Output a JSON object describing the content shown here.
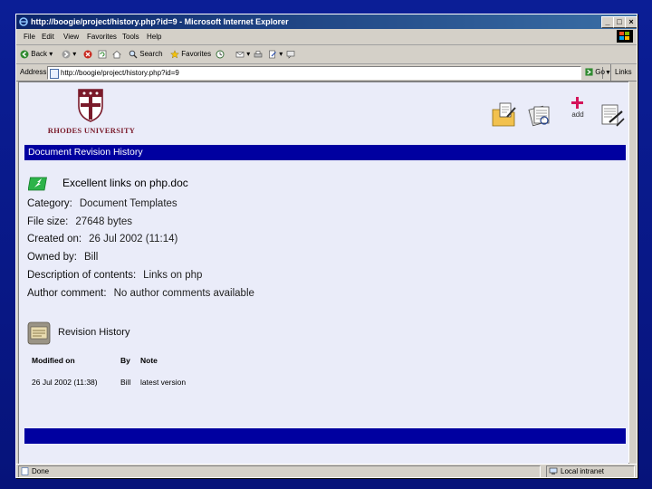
{
  "window": {
    "title": "http://boogie/project/history.php?id=9 - Microsoft Internet Explorer",
    "min": "_",
    "max": "□",
    "close": "×"
  },
  "menu": [
    "File",
    "Edit",
    "View",
    "Favorites",
    "Tools",
    "Help"
  ],
  "toolbar": {
    "back": "Back",
    "search": "Search",
    "favorites": "Favorites"
  },
  "address": {
    "label": "Address",
    "url": "http://boogie/project/history.php?id=9",
    "go": "Go",
    "links": "Links"
  },
  "logo": {
    "text": "RHODES UNIVERSITY"
  },
  "header_icons": {
    "add_label": "add"
  },
  "section": {
    "title": "Document Revision History"
  },
  "document": {
    "title": "Excellent links on php.doc",
    "fields": [
      {
        "label": "Category:",
        "value": "Document Templates"
      },
      {
        "label": "File size:",
        "value": "27648 bytes"
      },
      {
        "label": "Created on:",
        "value": "26 Jul 2002 (11:14)"
      },
      {
        "label": "Owned by:",
        "value": "Bill"
      },
      {
        "label": "Description of contents:",
        "value": "Links on php"
      },
      {
        "label": "Author comment:",
        "value": "No author comments available"
      }
    ]
  },
  "revision": {
    "title": "Revision History",
    "columns": [
      "Modified on",
      "By",
      "Note"
    ],
    "rows": [
      [
        "26 Jul 2002 (11:38)",
        "Bill",
        "latest version"
      ]
    ]
  },
  "status": {
    "left": "Done",
    "zone": "Local intranet"
  },
  "colors": {
    "slide_bg": "#0b1e96",
    "section_bar": "#0000a0",
    "content_bg": "#eaecf9",
    "logo_red": "#7a1a2a"
  }
}
